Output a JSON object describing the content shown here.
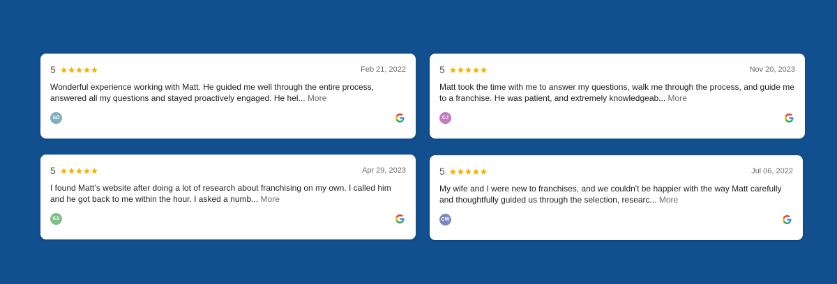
{
  "reviews": [
    {
      "rating": "5",
      "date": "Feb 21, 2022",
      "text": "Wonderful experience working with Matt. He guided me well through the entire process, answered all my questions and stayed proactively engaged. He hel...",
      "more": "More",
      "initials": "SD",
      "avatar_color": "#7FB0BE"
    },
    {
      "rating": "5",
      "date": "Nov 20, 2023",
      "text": "Matt took the time with me to answer my questions, walk me through the process, and guide me to a franchise. He was patient, and extremely knowledgeab...",
      "more": "More",
      "initials": "CJ",
      "avatar_color": "#C27BBF"
    },
    {
      "rating": "5",
      "date": "Apr 29, 2023",
      "text": "I found Matt’s website after doing a lot of research about franchising on my own. I called him and he got back to me within the hour. I asked a numb...",
      "more": "More",
      "initials": "KS",
      "avatar_color": "#7DC08A"
    },
    {
      "rating": "5",
      "date": "Jul 06, 2022",
      "text": "My wife and I were new to franchises, and we couldn't be happier with the way Matt carefully and thoughtfully guided us through the selection, researc...",
      "more": "More",
      "initials": "CW",
      "avatar_color": "#7C88C4"
    }
  ],
  "star_color": "#F4B400",
  "background_color": "#124F8F",
  "source_icon": "google-icon"
}
